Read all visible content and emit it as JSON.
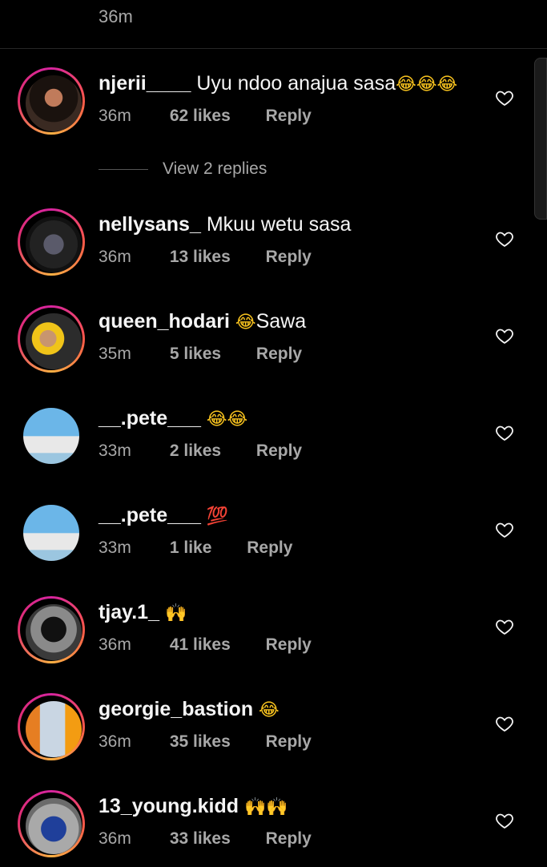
{
  "top": {
    "time": "36m"
  },
  "view_replies": {
    "label": "View 2 replies"
  },
  "comments": [
    {
      "username": "njerii____",
      "text": "Uyu ndoo anajua sasa",
      "emoji": "😂😂😂",
      "time": "36m",
      "likes": "62 likes",
      "reply": "Reply"
    },
    {
      "username": "nellysans_",
      "text": "Mkuu wetu sasa",
      "emoji": "",
      "time": "36m",
      "likes": "13 likes",
      "reply": "Reply"
    },
    {
      "username": "queen_hodari",
      "text": "Sawa",
      "emoji": "😂",
      "time": "35m",
      "likes": "5 likes",
      "reply": "Reply"
    },
    {
      "username": "__.pete___",
      "text": "",
      "emoji": "😂😂",
      "time": "33m",
      "likes": "2 likes",
      "reply": "Reply"
    },
    {
      "username": "__.pete___",
      "text": "",
      "emoji": "💯",
      "time": "33m",
      "likes": "1 like",
      "reply": "Reply"
    },
    {
      "username": "tjay.1_",
      "text": "",
      "emoji": "🙌",
      "time": "36m",
      "likes": "41 likes",
      "reply": "Reply"
    },
    {
      "username": "georgie_bastion",
      "text": "",
      "emoji": "😂",
      "time": "36m",
      "likes": "35 likes",
      "reply": "Reply"
    },
    {
      "username": "13_young.kidd",
      "text": "",
      "emoji": "🙌🙌",
      "time": "36m",
      "likes": "33 likes",
      "reply": "Reply"
    }
  ],
  "icons": {
    "like": "heart-outline-icon"
  },
  "colors": {
    "background": "#000000",
    "secondary_text": "#a8a8a8",
    "story_ring": "#e1306c"
  }
}
